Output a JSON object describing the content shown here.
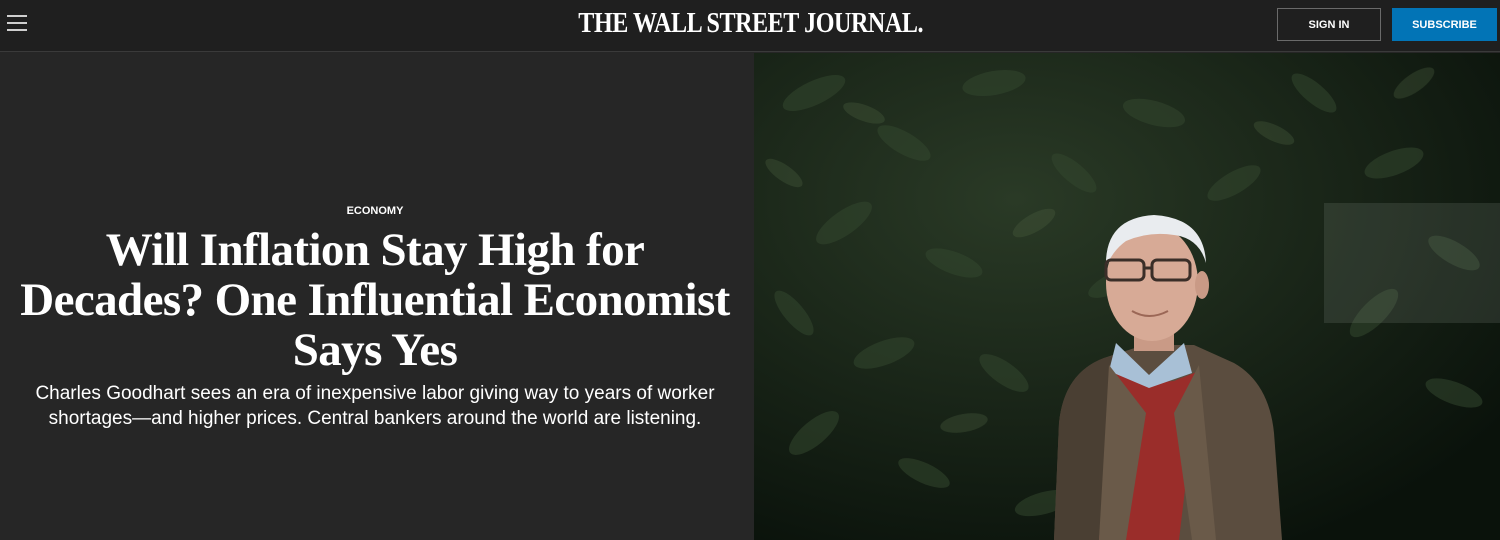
{
  "header": {
    "masthead": "THE WALL STREET JOURNAL.",
    "sign_in_label": "SIGN IN",
    "subscribe_label": "SUBSCRIBE"
  },
  "article": {
    "section": "ECONOMY",
    "headline": "Will Inflation Stay High for Decades? One Influential Economist Says Yes",
    "dek": "Charles Goodhart sees an era of inexpensive labor giving way to years of worker shortages—and higher prices. Central bankers around the world are listening."
  },
  "colors": {
    "background": "#262626",
    "header_background": "#1f1f1f",
    "subscribe_accent": "#0274b6"
  },
  "icons": [
    "menu-icon"
  ]
}
